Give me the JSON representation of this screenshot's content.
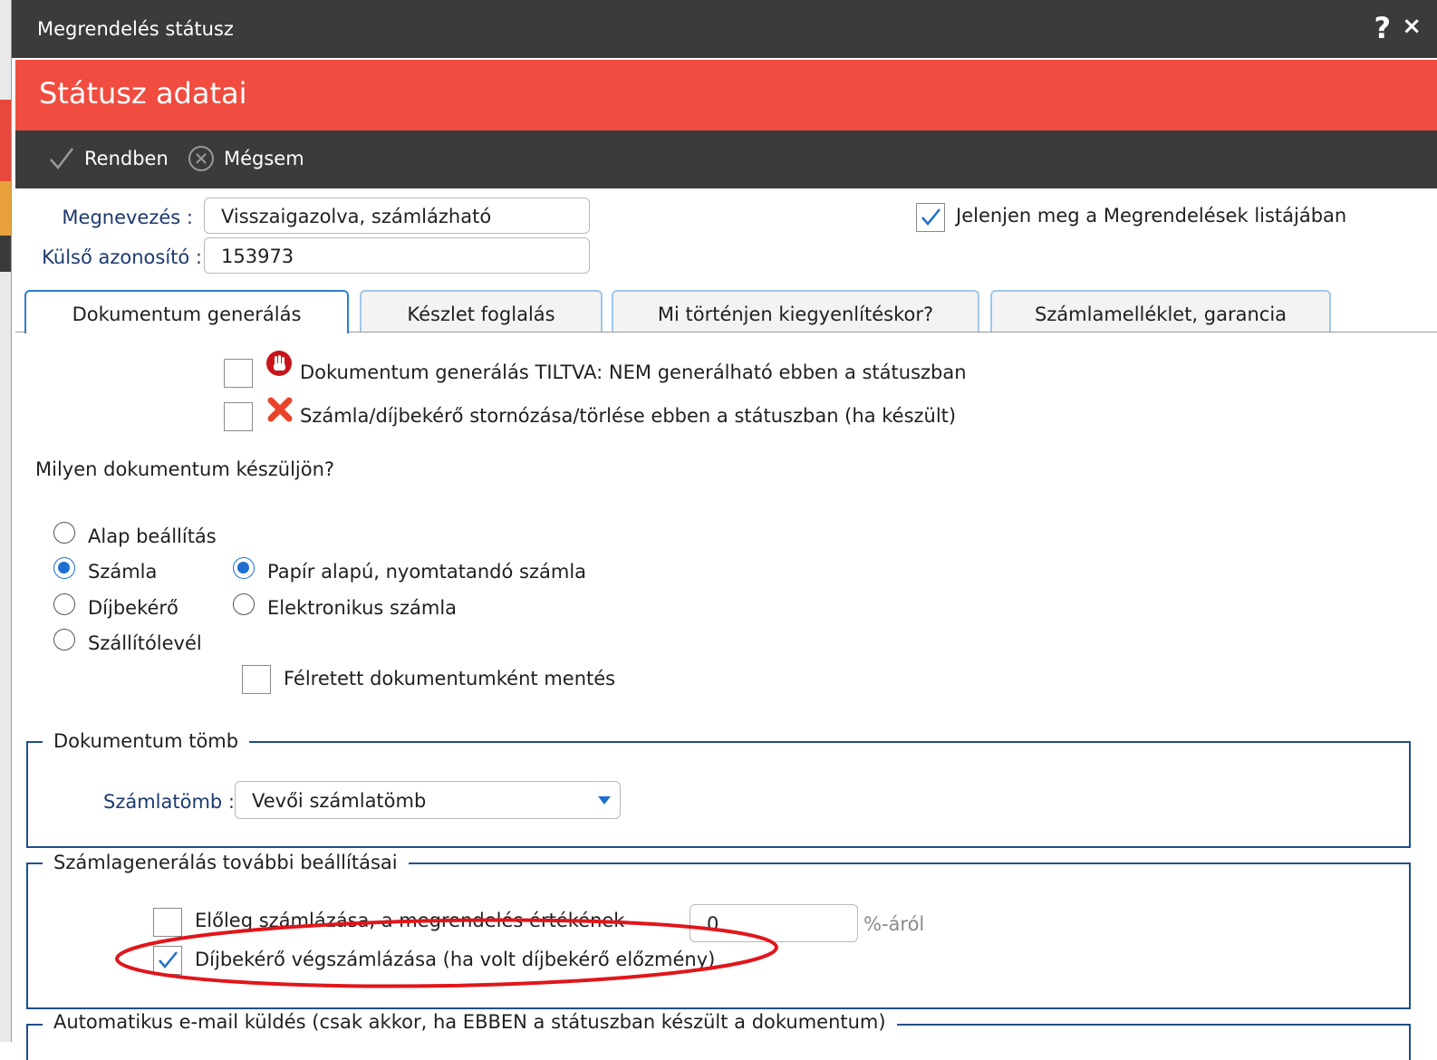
{
  "window": {
    "title": "Megrendelés státusz",
    "help_label": "?",
    "close_label": "×"
  },
  "header": {
    "title": "Státusz adatai"
  },
  "toolbar": {
    "ok_label": "Rendben",
    "cancel_label": "Mégsem"
  },
  "form": {
    "name_label": "Megnevezés :",
    "name_value": "Visszaigazolva, számlázható",
    "ext_id_label": "Külső azonosító :",
    "ext_id_value": "153973",
    "show_in_list_label": "Jelenjen meg a Megrendelések listájában",
    "show_in_list_checked": true
  },
  "tabs": [
    {
      "label": "Dokumentum generálás",
      "active": true
    },
    {
      "label": "Készlet foglalás",
      "active": false
    },
    {
      "label": "Mi történjen kiegyenlítéskor?",
      "active": false
    },
    {
      "label": "Számlamelléklet, garancia",
      "active": false
    }
  ],
  "doc_tab": {
    "forbid_label": "Dokumentum generálás TILTVA: NEM generálható ebben a státuszban",
    "forbid_icon": "stop-hand-icon",
    "storno_label": "Számla/díjbekérő stornózása/törlése ebben a státuszban (ha készült)",
    "storno_icon": "red-x-icon",
    "question": "Milyen dokumentum készüljön?",
    "doc_types": [
      {
        "label": "Alap beállítás",
        "selected": false
      },
      {
        "label": "Számla",
        "selected": true
      },
      {
        "label": "Díjbekérő",
        "selected": false
      },
      {
        "label": "Szállítólevél",
        "selected": false
      }
    ],
    "invoice_types": [
      {
        "label": "Papír alapú, nyomtatandó számla",
        "selected": true
      },
      {
        "label": "Elektronikus számla",
        "selected": false
      }
    ],
    "draft_label": "Félretett dokumentumként mentés",
    "block_legend": "Dokumentum tömb",
    "block_label": "Számlatömb :",
    "block_value": "Vevői számlatömb",
    "more_legend": "Számlagenerálás további beállításai",
    "advance_label": "Előleg számlázása, a megrendelés értékének",
    "advance_value": "0",
    "advance_unit": "%-áról",
    "final_invoice_label": "Díjbekérő végszámlázása (ha volt díjbekérő előzmény)",
    "final_invoice_checked": true,
    "email_legend": "Automatikus e-mail küldés (csak akkor, ha EBBEN a státuszban készült a dokumentum)"
  },
  "colors": {
    "titlebar": "#3b3b3b",
    "header": "#f04c3f",
    "label_blue": "#1c3a6e",
    "accent_blue": "#1e6fd0",
    "annotation_red": "#e0161b"
  }
}
